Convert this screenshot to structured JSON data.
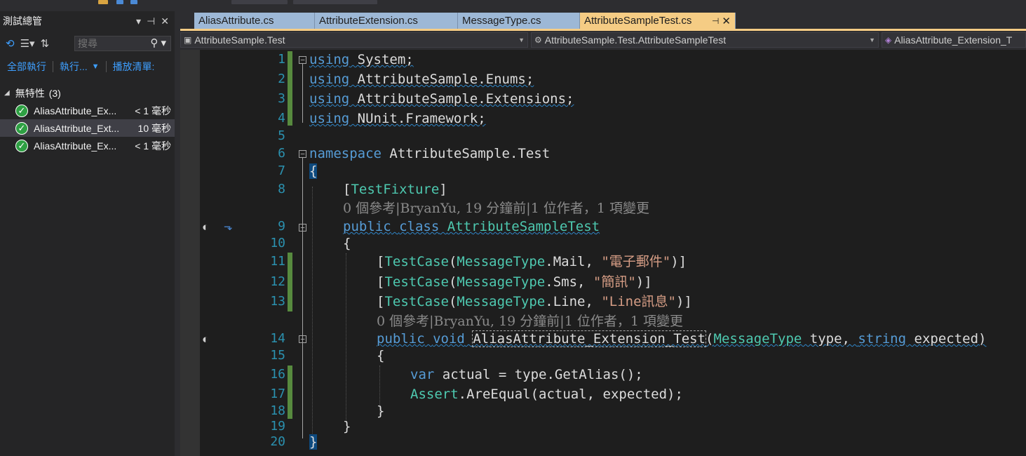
{
  "explorer": {
    "title": "測試總管",
    "search_placeholder": "搜尋",
    "actions": {
      "run_all": "全部執行",
      "run": "執行...",
      "playlist": "播放清單:"
    },
    "group": {
      "label": "無特性",
      "count": "(3)"
    },
    "tests": [
      {
        "name": "AliasAttribute_Ex...",
        "duration": "< 1 毫秒",
        "status": "passed"
      },
      {
        "name": "AliasAttribute_Ext...",
        "duration": "10 毫秒",
        "status": "passed"
      },
      {
        "name": "AliasAttribute_Ex...",
        "duration": "< 1 毫秒",
        "status": "passed"
      }
    ]
  },
  "tabs": [
    {
      "label": "AliasAttribute.cs",
      "active": false
    },
    {
      "label": "AttributeExtension.cs",
      "active": false
    },
    {
      "label": "MessageType.cs",
      "active": false
    },
    {
      "label": "AttributeSampleTest.cs",
      "active": true
    }
  ],
  "navbar": {
    "project": "AttributeSample.Test",
    "type": "AttributeSample.Test.AttributeSampleTest",
    "member": "AliasAttribute_Extension_T"
  },
  "code_lens": {
    "class": "0 個參考|BryanYu, 19 分鐘前|1 位作者，1 項變更",
    "method": "0 個參考|BryanYu, 19 分鐘前|1 位作者，1 項變更"
  },
  "code": {
    "l1": [
      "using",
      " System;"
    ],
    "l2": [
      "using",
      " AttributeSample.Enums;"
    ],
    "l3": [
      "using",
      " AttributeSample.Extensions;"
    ],
    "l4": [
      "using",
      " NUnit.Framework;"
    ],
    "l6": [
      "namespace",
      " AttributeSample.Test"
    ],
    "l7": "{",
    "l8": [
      "[",
      "TestFixture",
      "]"
    ],
    "l9": [
      "public",
      " ",
      "class",
      " ",
      "AttributeSampleTest"
    ],
    "l10": "{",
    "l11": [
      "[",
      "TestCase",
      "(",
      "MessageType",
      ".Mail, ",
      "\"電子郵件\"",
      ")]"
    ],
    "l12": [
      "[",
      "TestCase",
      "(",
      "MessageType",
      ".Sms, ",
      "\"簡訊\"",
      ")]"
    ],
    "l13": [
      "[",
      "TestCase",
      "(",
      "MessageType",
      ".Line, ",
      "\"Line訊息\"",
      ")]"
    ],
    "l14": [
      "public",
      " ",
      "void",
      " ",
      "AliasAttribute_Extension_Test",
      "(",
      "MessageType",
      " type, ",
      "string",
      " expected)"
    ],
    "l15": "{",
    "l16": [
      "var",
      " actual = type.GetAlias();"
    ],
    "l17": [
      "Assert",
      ".AreEqual(actual, expected);"
    ],
    "l18": "}",
    "l19": "}",
    "l20": "}"
  },
  "line_numbers": [
    "1",
    "2",
    "3",
    "4",
    "5",
    "6",
    "7",
    "8",
    "9",
    "10",
    "11",
    "12",
    "13",
    "14",
    "15",
    "16",
    "17",
    "18",
    "19",
    "20"
  ],
  "colors": {
    "keyword": "#569cd6",
    "type": "#4ec9b0",
    "string": "#d69d85",
    "line_number": "#2b91af",
    "active_tab": "#f5cc84",
    "inactive_tab": "#9db8d6"
  }
}
